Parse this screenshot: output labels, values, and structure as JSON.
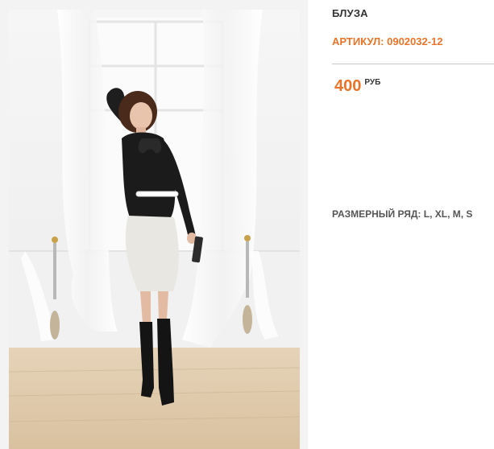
{
  "product": {
    "title": "БЛУЗА",
    "sku_label": "АРТИКУЛ:",
    "sku_value": "0902032-12",
    "price_value": "400",
    "price_currency": "РУБ",
    "sizes_label": "РАЗМЕРНЫЙ РЯД:",
    "sizes_value": "L, XL, M, S"
  },
  "colors": {
    "accent": "#e8742a",
    "text": "#333333"
  }
}
